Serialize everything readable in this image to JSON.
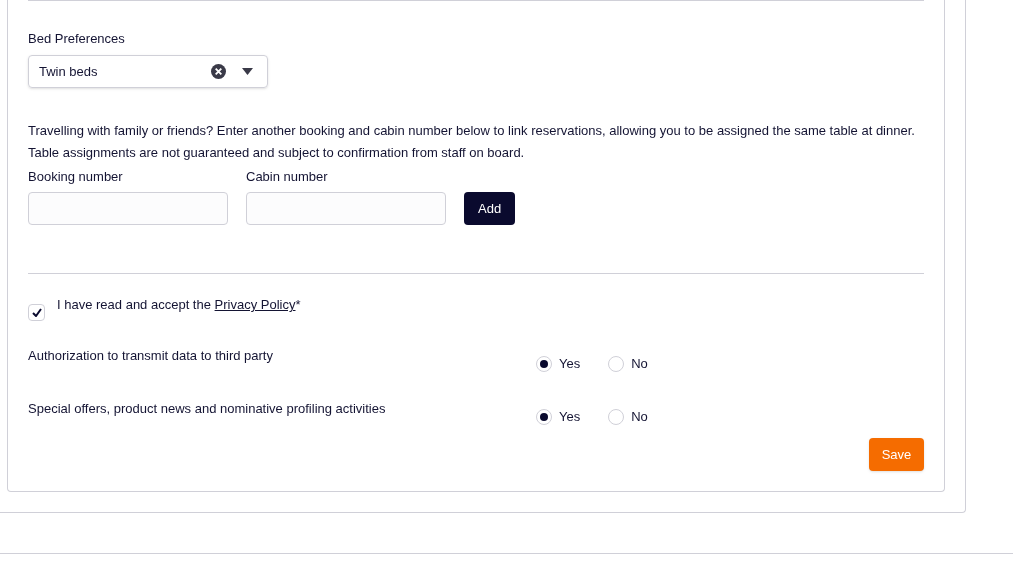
{
  "bed_preferences": {
    "label": "Bed Preferences",
    "value": "Twin beds"
  },
  "link_booking": {
    "description": "Travelling with family or friends? Enter another booking and cabin number below to link reservations, allowing you to be assigned the same table at dinner. Table assignments are not guaranteed and subject to confirmation from staff on board.",
    "fields": [
      {
        "label": "Booking number"
      },
      {
        "label": "Cabin number"
      }
    ],
    "add_button": "Add"
  },
  "privacy": {
    "text_before": "I have read and accept the",
    "link": "Privacy Policy",
    "text_after": "*",
    "checked": true
  },
  "consents": [
    {
      "label": "Authorization to transmit data to third party",
      "options": [
        {
          "label": "Yes",
          "selected": true
        },
        {
          "label": "No",
          "selected": false
        }
      ]
    },
    {
      "label": "Special offers, product news and nominative profiling activities",
      "options": [
        {
          "label": "Yes",
          "selected": true
        },
        {
          "label": "No",
          "selected": false
        }
      ]
    }
  ],
  "save_button": "Save"
}
